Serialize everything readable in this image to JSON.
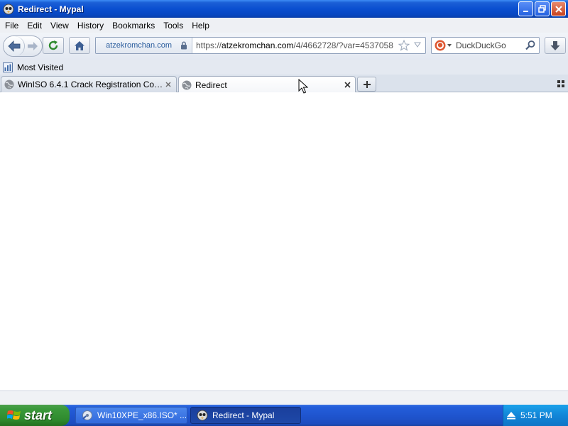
{
  "window": {
    "title": "Redirect - Mypal"
  },
  "menu": {
    "items": [
      {
        "label": "File"
      },
      {
        "label": "Edit"
      },
      {
        "label": "View"
      },
      {
        "label": "History"
      },
      {
        "label": "Bookmarks"
      },
      {
        "label": "Tools"
      },
      {
        "label": "Help"
      }
    ]
  },
  "navbar": {
    "identity_domain": "atzekromchan.com",
    "url_prefix": "https://",
    "url_host": "atzekromchan.com",
    "url_path": "/4/4662728/?var=4537058",
    "search_placeholder": "DuckDuckGo"
  },
  "bookmarks": {
    "most_visited": "Most Visited"
  },
  "tabs": [
    {
      "label": "WinISO 6.4.1 Crack Registration Code With Keygen",
      "active": false
    },
    {
      "label": "Redirect",
      "active": true
    }
  ],
  "taskbar": {
    "start_label": "start",
    "tasks": [
      {
        "label": "Win10XPE_x86.ISO* ...",
        "active": false
      },
      {
        "label": "Redirect - Mypal",
        "active": true
      }
    ],
    "clock": "5:51 PM"
  },
  "colors": {
    "titlebar": "#0a4fd0",
    "taskbar": "#245edb",
    "start_button": "#3b9a3a",
    "tray": "#1286d8"
  }
}
